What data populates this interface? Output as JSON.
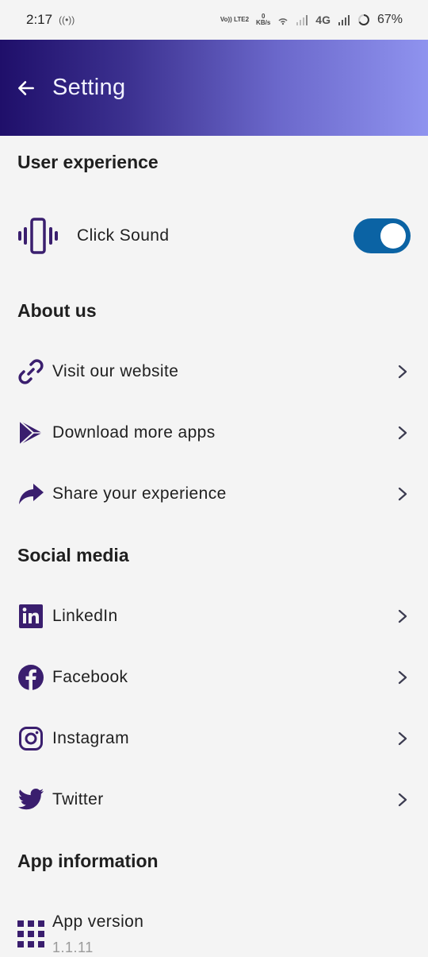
{
  "status_bar": {
    "time": "2:17",
    "volte": "Vo)) LTE2",
    "speed_value": "0",
    "speed_unit": "KB/s",
    "network": "4G",
    "battery": "67%"
  },
  "app_bar": {
    "title": "Setting"
  },
  "sections": {
    "user_experience": "User experience",
    "about_us": "About us",
    "social_media": "Social media",
    "app_information": "App information"
  },
  "user_experience": {
    "click_sound_label": "Click Sound",
    "click_sound_on": true
  },
  "about_items": [
    {
      "label": "Visit our website",
      "icon": "link-icon"
    },
    {
      "label": "Download more apps",
      "icon": "play-store-icon"
    },
    {
      "label": "Share your experience",
      "icon": "share-icon"
    }
  ],
  "social_items": [
    {
      "label": "LinkedIn",
      "icon": "linkedin-icon"
    },
    {
      "label": "Facebook",
      "icon": "facebook-icon"
    },
    {
      "label": "Instagram",
      "icon": "instagram-icon"
    },
    {
      "label": "Twitter",
      "icon": "twitter-icon"
    }
  ],
  "app_info": {
    "version_label": "App version",
    "version_value": "1.1.11"
  },
  "colors": {
    "icon": "#3a1e6e",
    "toggle": "#0b63a4",
    "header_start": "#1f0f6a",
    "header_end": "#8f93ef"
  }
}
